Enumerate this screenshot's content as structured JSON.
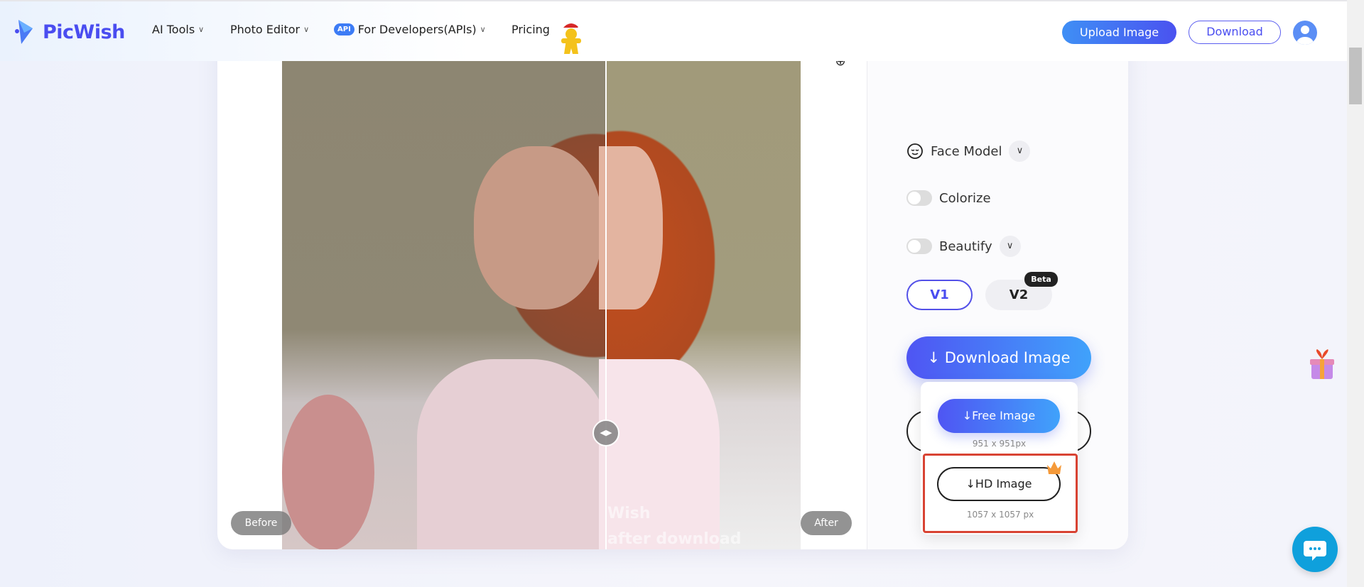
{
  "header": {
    "brand": "PicWish",
    "nav": [
      {
        "label": "AI Tools",
        "has_dropdown": true
      },
      {
        "label": "Photo Editor",
        "has_dropdown": true
      },
      {
        "label": "For Developers(APIs)",
        "badge": "API",
        "has_dropdown": true
      },
      {
        "label": "Pricing",
        "has_dropdown": false
      }
    ],
    "upload_button": "Upload Image",
    "download_button": "Download"
  },
  "preview": {
    "before_label": "Before",
    "after_label": "After",
    "watermark_lines": [
      "Wish",
      "after download"
    ]
  },
  "panel": {
    "face_model": "Face Model",
    "colorize": {
      "label": "Colorize",
      "on": false
    },
    "beautify": {
      "label": "Beautify",
      "on": false
    },
    "versions": [
      {
        "label": "V1",
        "selected": true
      },
      {
        "label": "V2",
        "badge": "Beta",
        "selected": false
      }
    ],
    "download_image": "Download Image",
    "dropdown": {
      "free_label": "Free Image",
      "free_size": "951 x 951px",
      "hd_label": "HD Image",
      "hd_size": "1057 x 1057 px"
    }
  },
  "colors": {
    "accent": "#4a4df0",
    "highlight": "#d84333",
    "chat": "#0fa0dc"
  }
}
